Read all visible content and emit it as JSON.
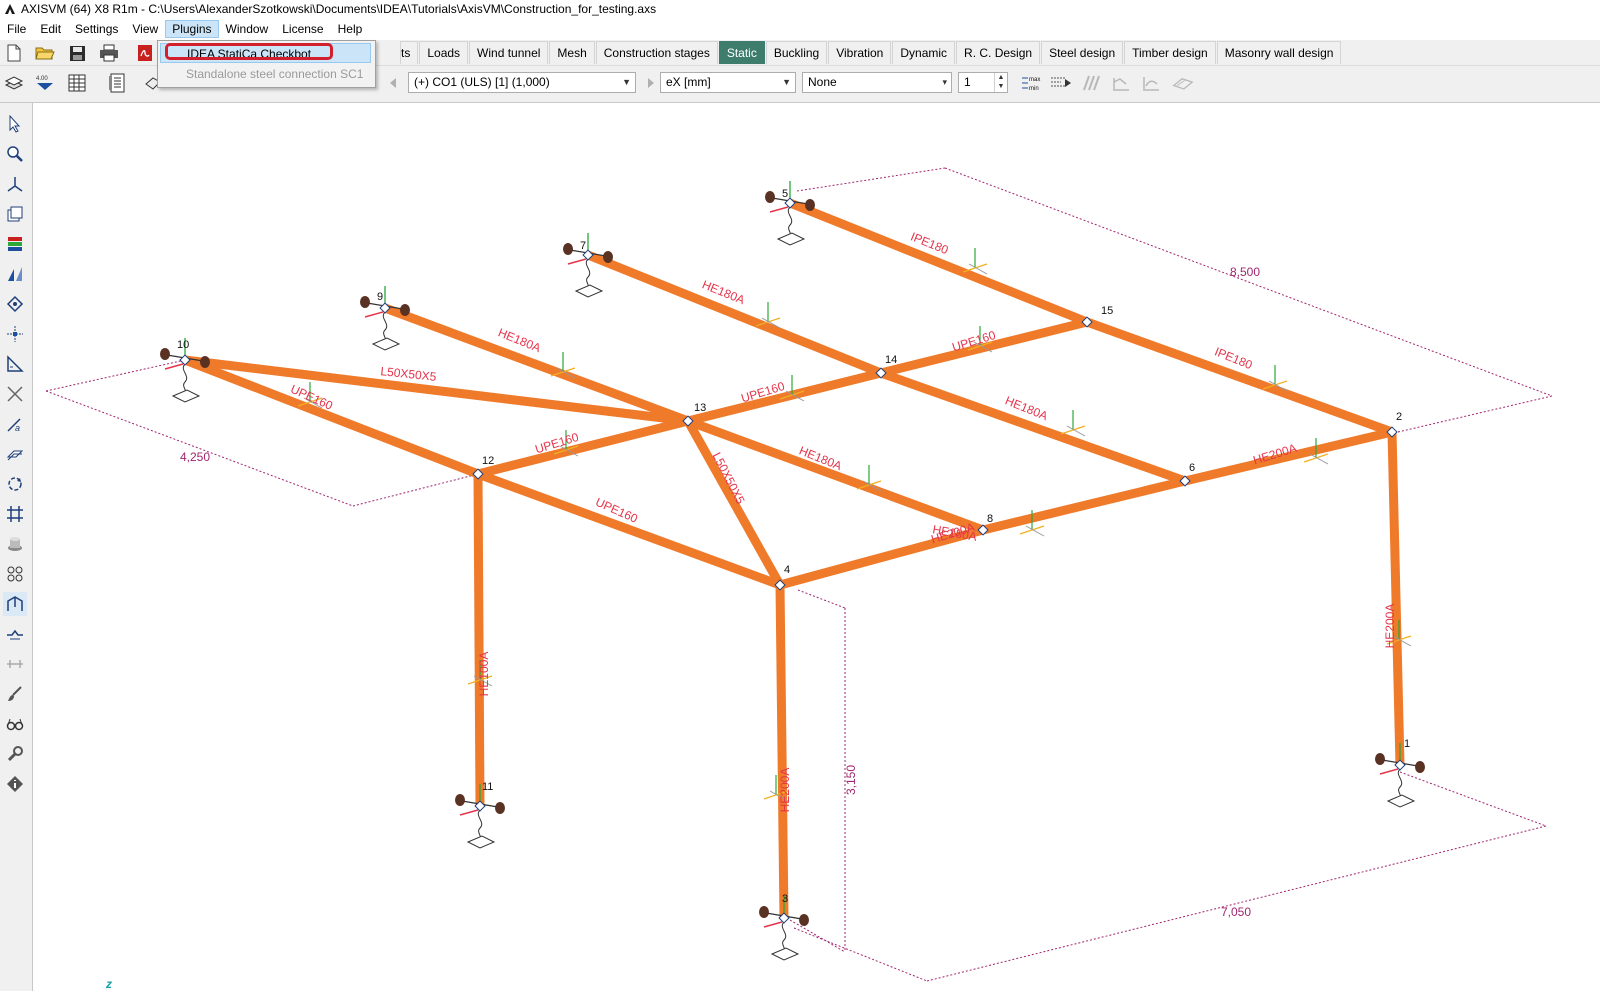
{
  "titlebar": {
    "app_icon": "axisvm-logo-icon",
    "title": "AXISVM (64) X8 R1m - C:\\Users\\AlexanderSzotkowski\\Documents\\IDEA\\Tutorials\\AxisVM\\Construction_for_testing.axs"
  },
  "menubar": {
    "items": [
      "File",
      "Edit",
      "Settings",
      "View",
      "Plugins",
      "Window",
      "License",
      "Help"
    ],
    "active": "Plugins"
  },
  "plugins_menu": {
    "items": [
      {
        "label": "IDEA StatiCa Checkbot",
        "state": "highlighted"
      },
      {
        "label": "Standalone steel connection SC1",
        "state": "disabled"
      }
    ],
    "highlight_color": "#d21f2d"
  },
  "toolbar": {
    "tabs": [
      "ts",
      "Loads",
      "Wind tunnel",
      "Mesh",
      "Construction stages",
      "Static",
      "Buckling",
      "Vibration",
      "Dynamic",
      "R. C. Design",
      "Steel design",
      "Timber design",
      "Masonry wall design"
    ],
    "active_tab": "Static",
    "active_tab_color": "#3e7d6b"
  },
  "result_bar": {
    "load_combination": "(+) CO1 (ULS) [1] (1,000)",
    "component": "eX [mm]",
    "display": "None",
    "step": "1"
  },
  "sidebar": {
    "tools": [
      "pointer-icon",
      "zoom-icon",
      "axes-icon",
      "copy-view-icon",
      "layers-icon",
      "render-icon",
      "node-icon",
      "dimension-icon",
      "measure-icon",
      "cut-icon",
      "label-icon",
      "layer-plane-icon",
      "rotate-icon",
      "grid-icon",
      "solid-icon",
      "mesh-icon",
      "frame-icon",
      "support-icon",
      "beam-icon",
      "brush-icon",
      "glasses-icon",
      "wrench-icon",
      "info-icon"
    ],
    "selected": "frame-icon"
  },
  "model": {
    "colors": {
      "member": "#ef7a2a",
      "label": "#e5344a",
      "dimension": "#a0266f",
      "axis_green": "#2aa838",
      "support": "#5a3224"
    },
    "dimensions": [
      "8,500",
      "4,250",
      "3,150",
      "7,050"
    ],
    "nodes": [
      "1",
      "2",
      "3",
      "4",
      "5",
      "6",
      "7",
      "8",
      "9",
      "10",
      "11",
      "12",
      "13",
      "14",
      "15"
    ],
    "member_labels": [
      "IPE180",
      "IPE180",
      "HE180A",
      "HE180A",
      "HE180A",
      "HE180A",
      "HE180A",
      "UPE160",
      "UPE160",
      "UPE160",
      "UPE160",
      "UPE160",
      "L50X50X5",
      "L50X50X5",
      "HE200A",
      "HE200A",
      "HE200A",
      "HE200A",
      "HE100A"
    ],
    "axis_marker": "z"
  }
}
